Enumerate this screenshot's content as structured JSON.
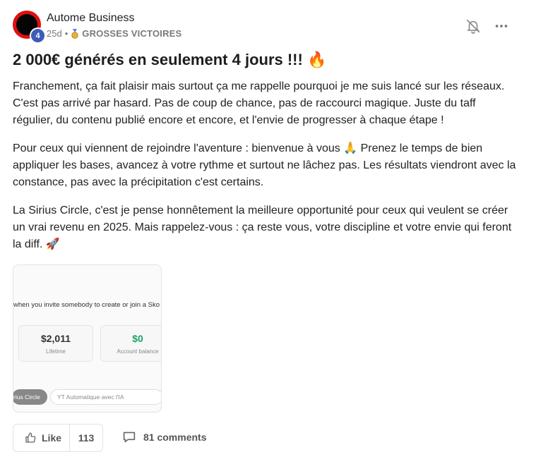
{
  "post": {
    "author": "Autome Business",
    "level": "4",
    "age": "25d",
    "separator": "•",
    "category": "GROSSES VICTOIRES",
    "title": "2 000€ générés en seulement 4 jours !!! 🔥",
    "paragraphs": [
      "Franchement, ça fait plaisir mais surtout ça me rappelle pourquoi je me suis lancé sur les réseaux. C'est pas arrivé par hasard. Pas de coup de chance, pas de raccourci magique. Juste du taff régulier, du contenu publié encore et encore, et l'envie de progresser à chaque étape !",
      "Pour ceux qui viennent de rejoindre l'aventure : bienvenue à vous 🙏 Prenez le temps de bien appliquer les bases, avancez à votre rythme et surtout ne lâchez pas. Les résultats viendront avec la constance, pas avec la précipitation c'est certains.",
      "La Sirius Circle, c'est je pense honnêtement la meilleure opportunité pour ceux qui veulent se créer un vrai revenu en 2025. Mais rappelez-vous : ça reste vous, votre discipline et votre envie qui feront la diff. 🚀"
    ]
  },
  "attachment": {
    "caption": "when you invite somebody to create or join a Sko",
    "stats": [
      {
        "value": "$2,011",
        "label": "Lifetime",
        "color": "#333333"
      },
      {
        "value": "$0",
        "label": "Account balance",
        "color": "#1fa463"
      }
    ],
    "chips": [
      "rius Circle",
      "YT Automatique avec l'IA"
    ]
  },
  "actions": {
    "like_label": "Like",
    "like_count": "113",
    "comments_label": "81 comments"
  },
  "icons": {
    "bell": "bell-off-icon",
    "more": "more-horizontal-icon",
    "medal": "medal-icon",
    "like": "thumbs-up-icon",
    "comment": "comment-icon"
  },
  "colors": {
    "avatar_ring": "#e01010",
    "level_badge": "#3d5bb7",
    "balance_green": "#1fa463"
  }
}
